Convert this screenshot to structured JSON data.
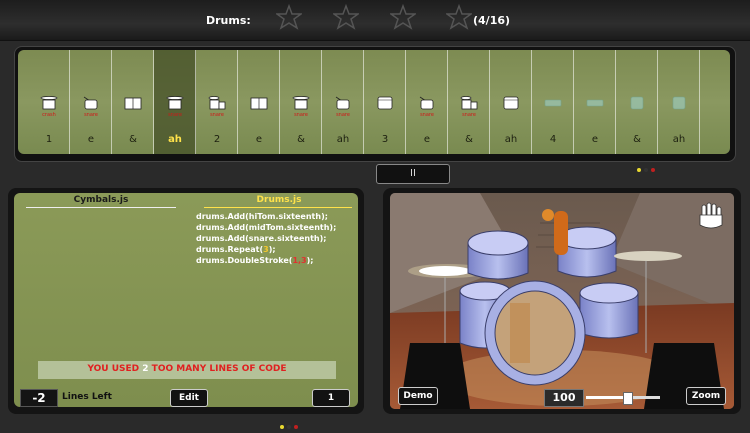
{
  "header": {
    "title": "Drums:",
    "progress": "(4/16)",
    "stars_earned": 0,
    "stars_total": 4
  },
  "sequencer": {
    "active_index": 3,
    "beats": [
      {
        "count": "1",
        "label": "crash",
        "icon": "cymbal-drum-icon"
      },
      {
        "count": "e",
        "label": "snare",
        "icon": "snare-drum-icon"
      },
      {
        "count": "&",
        "label": "",
        "icon": "tom-pair-icon"
      },
      {
        "count": "ah",
        "label": "snare",
        "icon": "cymbal-drum-icon"
      },
      {
        "count": "2",
        "label": "snare",
        "icon": "cymbal-tom-icon"
      },
      {
        "count": "e",
        "label": "",
        "icon": "tom-pair-icon"
      },
      {
        "count": "&",
        "label": "snare",
        "icon": "cymbal-drum-icon"
      },
      {
        "count": "ah",
        "label": "snare",
        "icon": "snare-drum-icon"
      },
      {
        "count": "3",
        "label": "",
        "icon": "floor-tom-icon"
      },
      {
        "count": "e",
        "label": "snare",
        "icon": "snare-drum-icon"
      },
      {
        "count": "&",
        "label": "snare",
        "icon": "cymbal-tom-icon"
      },
      {
        "count": "ah",
        "label": "",
        "icon": "floor-tom-icon"
      },
      {
        "count": "4",
        "label": "",
        "icon": "hihat-faded-icon"
      },
      {
        "count": "e",
        "label": "",
        "icon": "hihat-faded-icon"
      },
      {
        "count": "&",
        "label": "",
        "icon": "tom-faded-icon"
      },
      {
        "count": "ah",
        "label": "",
        "icon": "tom-faded-icon"
      }
    ],
    "pause_label": "II"
  },
  "code_panel": {
    "tabs": [
      "Cymbals.js",
      "Drums.js"
    ],
    "active_tab": 1,
    "lines": [
      {
        "text": "drums.Add(hiTom.sixteenth);"
      },
      {
        "text": "drums.Add(midTom.sixteenth);"
      },
      {
        "text": "drums.Add(snare.sixteenth);"
      },
      {
        "prefix": "drums.Repeat(",
        "arg": "3",
        "suffix": ");"
      },
      {
        "prefix": "drums.DoubleStroke(",
        "arg": "1,3",
        "suffix": ");"
      }
    ],
    "error": {
      "before": "YOU USED ",
      "num": "2",
      "after": " TOO MANY LINES OF CODE"
    },
    "lines_left_value": "-2",
    "lines_left_label": "Lines Left",
    "edit_label": "Edit",
    "page_label": "1"
  },
  "view_panel": {
    "demo_label": "Demo",
    "zoom_label": "Zoom",
    "tempo": "100",
    "tempo_fraction": 0.55
  },
  "colors": {
    "panel_green": "#8a9860",
    "highlight_yellow": "#ffe24a",
    "error_red": "#e02020"
  }
}
